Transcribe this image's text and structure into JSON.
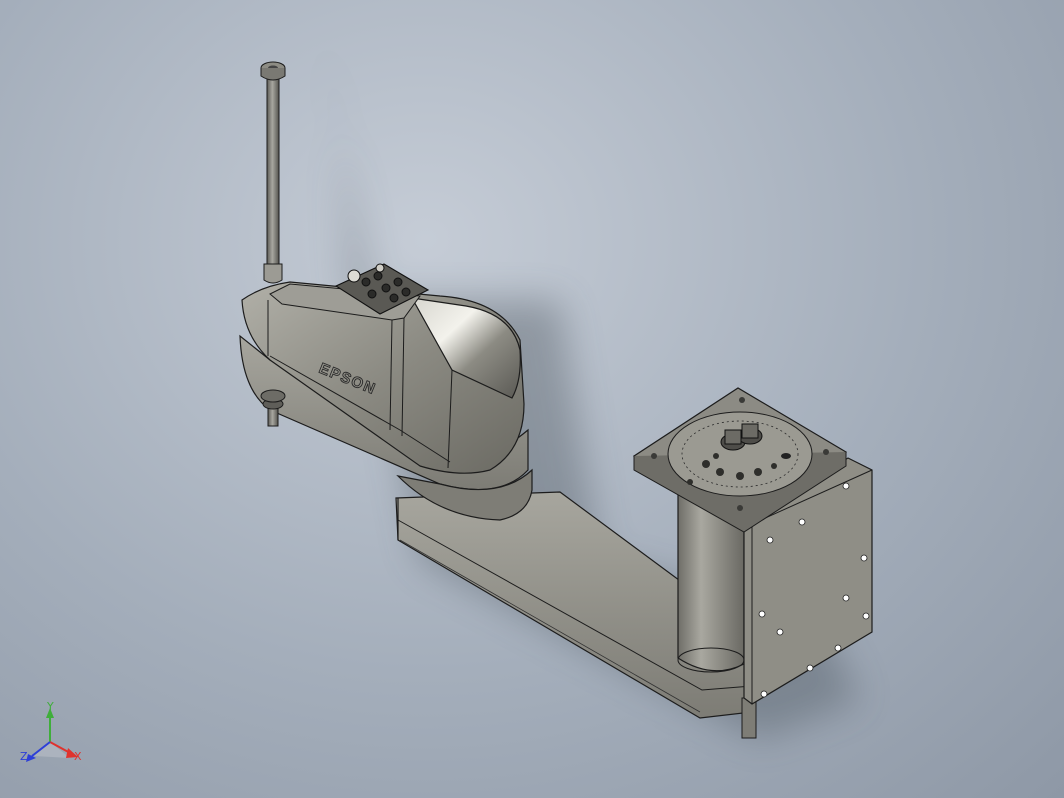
{
  "viewport": {
    "background": "#a9b3c0",
    "model": {
      "brand_text": "EPSON",
      "body_color": "#8d8c84",
      "body_dark": "#5e5d57",
      "edge_color": "#1c1c1c"
    }
  },
  "triad": {
    "x_label": "X",
    "y_label": "Y",
    "z_label": "Z",
    "x_color": "#e0322d",
    "y_color": "#3fae3a",
    "z_color": "#2d3fd8"
  }
}
